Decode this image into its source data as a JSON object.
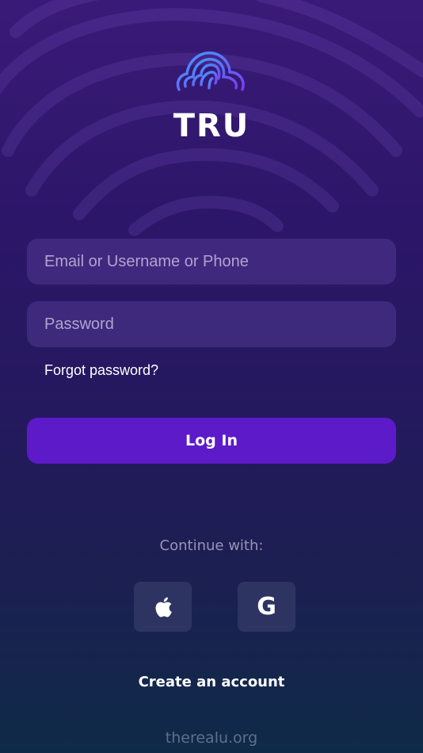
{
  "brand": {
    "name": "TRU"
  },
  "form": {
    "email_placeholder": "Email or Username or Phone",
    "password_placeholder": "Password",
    "forgot_label": "Forgot password?",
    "login_label": "Log In"
  },
  "social": {
    "continue_label": "Continue with:",
    "apple_icon": "apple-icon",
    "google_label": "G"
  },
  "create_account_label": "Create an account",
  "footer": {
    "domain": "therealu.org"
  },
  "colors": {
    "background_top": "#3a1a78",
    "background_bottom": "#0f2a48",
    "login_button": "#5d1ac9"
  }
}
